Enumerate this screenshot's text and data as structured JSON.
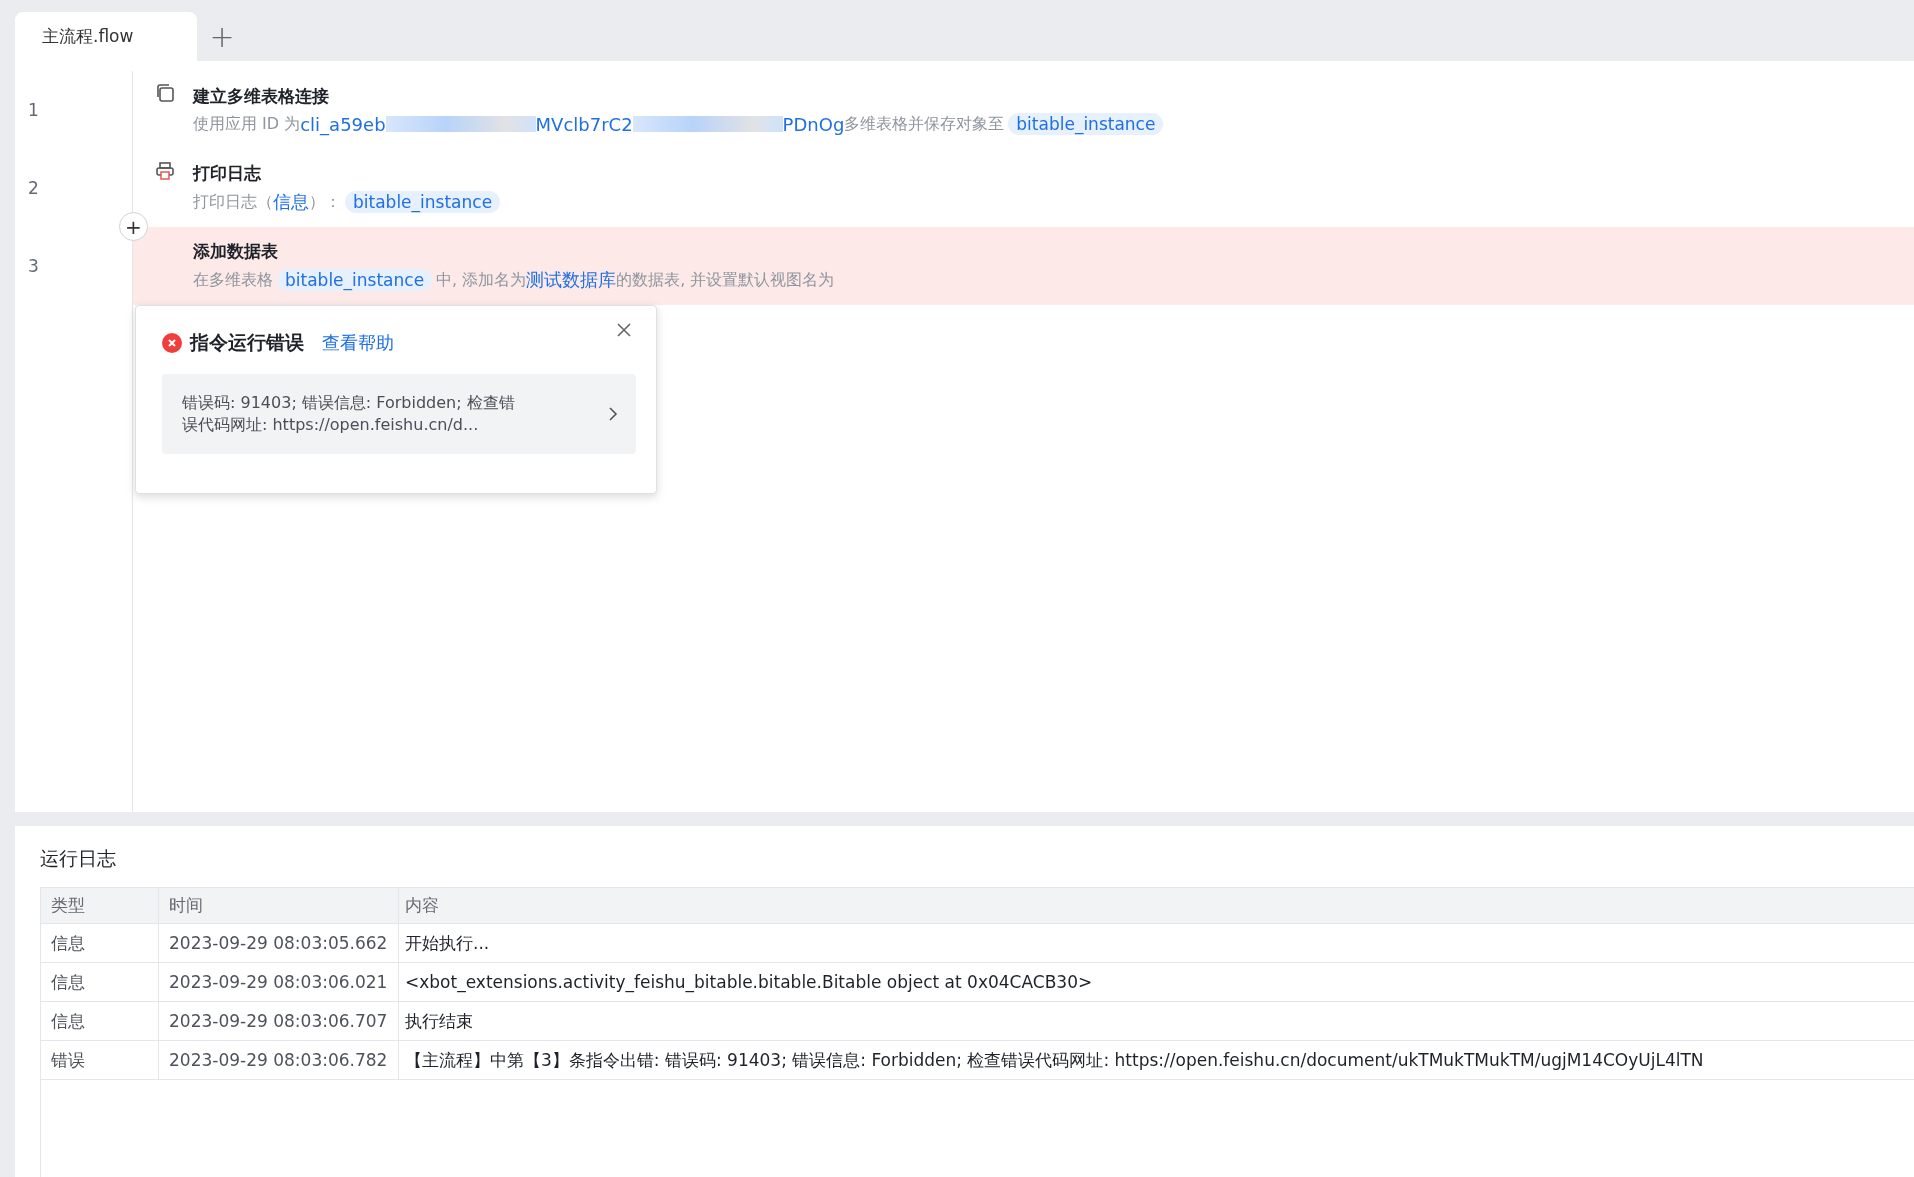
{
  "tabs": [
    {
      "label": "主流程.flow",
      "selected": true
    }
  ],
  "add_tab": "+",
  "steps": [
    {
      "number": "1",
      "kind": "connect",
      "title": "建立多维表格连接",
      "error": false,
      "parts": [
        {
          "kind": "text",
          "text": "使用应用 ID 为"
        },
        {
          "kind": "link",
          "text": "cli_a59eb"
        },
        {
          "kind": "redacted"
        },
        {
          "kind": "link",
          "text": "MVclb7rC2"
        },
        {
          "kind": "redacted"
        },
        {
          "kind": "link",
          "text": "PDnOg"
        },
        {
          "kind": "text",
          "text": "多维表格并保存对象至"
        },
        {
          "kind": "variable",
          "text": "bitable_instance"
        }
      ]
    },
    {
      "number": "2",
      "kind": "log",
      "title": "打印日志",
      "error": false,
      "parts": [
        {
          "kind": "text",
          "text": "打印日志（"
        },
        {
          "kind": "link",
          "text": "信息"
        },
        {
          "kind": "text",
          "text": "）："
        },
        {
          "kind": "variable",
          "text": "bitable_instance"
        }
      ]
    },
    {
      "number": "3",
      "kind": "table",
      "title": "添加数据表",
      "error": true,
      "parts": [
        {
          "kind": "text",
          "text": "在多维表格"
        },
        {
          "kind": "variable",
          "text": "bitable_instance"
        },
        {
          "kind": "text",
          "text": "中, 添加名为"
        },
        {
          "kind": "link",
          "text": "测试数据库"
        },
        {
          "kind": "text",
          "text": "的数据表, 并设置默认视图名为"
        }
      ]
    }
  ],
  "insert_button": "+",
  "error_popup": {
    "title": "指令运行错误",
    "help_link": "查看帮助",
    "message": "错误码: 91403; 错误信息: Forbidden; 检查错误代码网址: https://open.feishu.cn/d..."
  },
  "log": {
    "title": "运行日志",
    "columns": [
      "类型",
      "时间",
      "内容"
    ],
    "rows": [
      {
        "type": "信息",
        "time": "2023-09-29 08:03:05.662",
        "content": "开始执行..."
      },
      {
        "type": "信息",
        "time": "2023-09-29 08:03:06.021",
        "content": "<xbot_extensions.activity_feishu_bitable.bitable.Bitable object at 0x04CACB30>"
      },
      {
        "type": "信息",
        "time": "2023-09-29 08:03:06.707",
        "content": "执行结束"
      },
      {
        "type": "错误",
        "time": "2023-09-29 08:03:06.782",
        "content": "【主流程】中第【3】条指令出错:  错误码: 91403; 错误信息: Forbidden; 检查错误代码网址: https://open.feishu.cn/document/ukTMukTMukTM/ugjM14COyUjL4lTN"
      }
    ]
  }
}
